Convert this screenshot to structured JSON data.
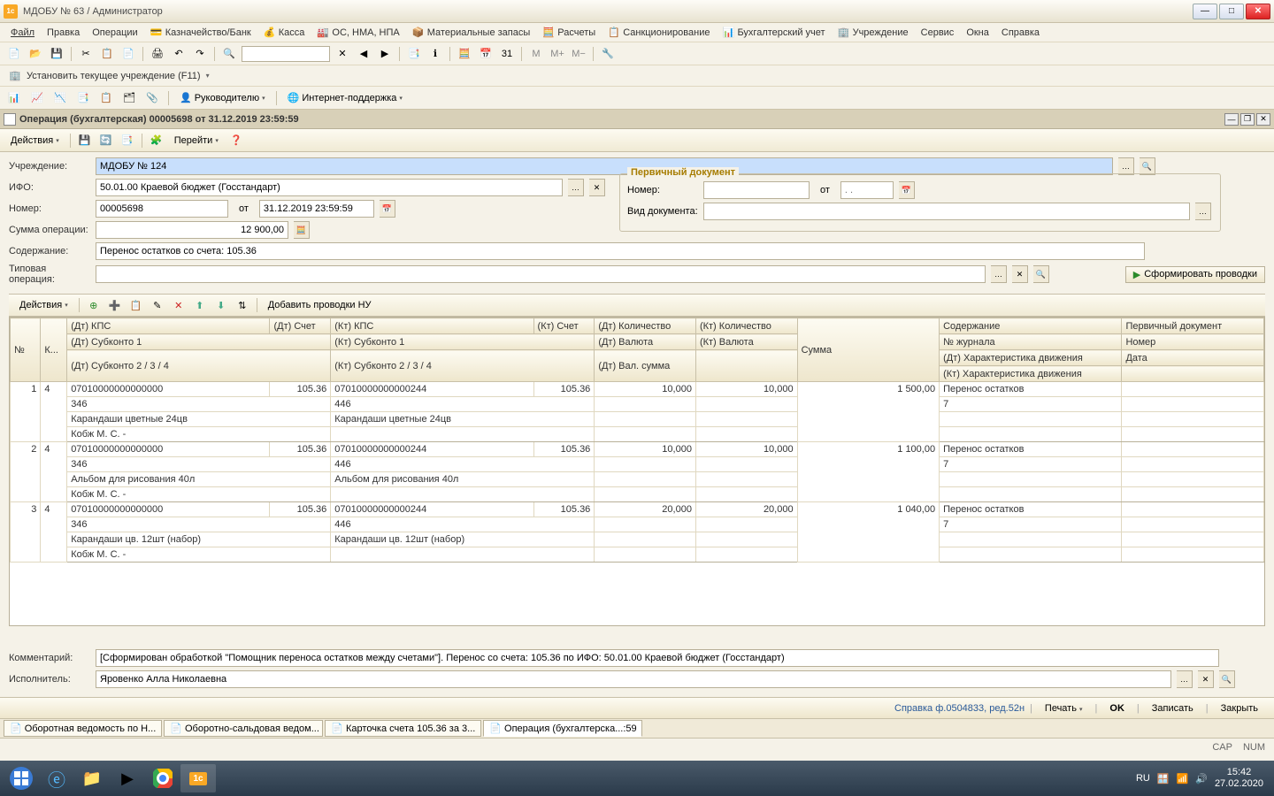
{
  "window": {
    "title": "МДОБУ № 63   / Администратор"
  },
  "menubar": [
    "Файл",
    "Правка",
    "Операции",
    "Казначейство/Банк",
    "Касса",
    "ОС, НМА, НПА",
    "Материальные запасы",
    "Расчеты",
    "Санкционирование",
    "Бухгалтерский учет",
    "Учреждение",
    "Сервис",
    "Окна",
    "Справка"
  ],
  "set_org": "Установить текущее учреждение (F11)",
  "toolbar2": {
    "manager": "Руководителю",
    "support": "Интернет-поддержка"
  },
  "doc_title": "Операция (бухгалтерская) 00005698 от 31.12.2019 23:59:59",
  "actions": {
    "label": "Действия",
    "go": "Перейти"
  },
  "form": {
    "org_label": "Учреждение:",
    "org_value": "МДОБУ № 124",
    "ifo_label": "ИФО:",
    "ifo_value": "50.01.00 Краевой бюджет (Госстандарт)",
    "num_label": "Номер:",
    "num_value": "00005698",
    "from": "от",
    "date_value": "31.12.2019 23:59:59",
    "sum_label": "Сумма операции:",
    "sum_value": "12 900,00",
    "content_label": "Содержание:",
    "content_value": "Перенос остатков со счета: 105.36",
    "typeop_label": "Типовая операция:"
  },
  "primary_doc": {
    "legend": "Первичный документ",
    "num_label": "Номер:",
    "from": "от",
    "date_placeholder": ". .",
    "kind_label": "Вид документа:"
  },
  "table_actions": {
    "actions": "Действия",
    "add_nu": "Добавить проводки НУ"
  },
  "gen_btn": "Сформировать проводки",
  "grid": {
    "headers": {
      "n": "№",
      "k": "К...",
      "dt_kps": "(Дт) КПС",
      "dt_acc": "(Дт) Счет",
      "kt_kps": "(Кт) КПС",
      "kt_acc": "(Кт) Счет",
      "dt_qty": "(Дт) Количество",
      "kt_qty": "(Кт) Количество",
      "sum": "Сумма",
      "content": "Содержание",
      "primdoc": "Первичный документ",
      "dt_sub1": "(Дт) Субконто 1",
      "kt_sub1": "(Кт) Субконто 1",
      "dt_cur": "(Дт) Валюта",
      "kt_cur": "(Кт) Валюта",
      "journal": "№ журнала",
      "pd_num": "Номер",
      "dt_sub234": "(Дт) Субконто 2 / 3 / 4",
      "kt_sub234": "(Кт) Субконто 2 / 3 / 4",
      "dt_valsum": "(Дт) Вал. сумма",
      "dt_char": "(Дт) Характеристика движения",
      "pd_date": "Дата",
      "kt_char": "(Кт) Характеристика движения"
    },
    "rows": [
      {
        "n": "1",
        "k": "4",
        "dt_kps": "07010000000000000",
        "dt_acc": "105.36",
        "kt_kps": "07010000000000244",
        "kt_acc": "105.36",
        "dt_qty": "10,000",
        "kt_qty": "10,000",
        "sum": "1 500,00",
        "content": "Перенос остатков",
        "dt_sub1": "346",
        "kt_sub1": "446",
        "journal": "7",
        "dt_sub2": "Карандаши цветные  24цв",
        "kt_sub2": "Карандаши цветные  24цв",
        "dt_sub3": "Кобж М. С. -"
      },
      {
        "n": "2",
        "k": "4",
        "dt_kps": "07010000000000000",
        "dt_acc": "105.36",
        "kt_kps": "07010000000000244",
        "kt_acc": "105.36",
        "dt_qty": "10,000",
        "kt_qty": "10,000",
        "sum": "1 100,00",
        "content": "Перенос остатков",
        "dt_sub1": "346",
        "kt_sub1": "446",
        "journal": "7",
        "dt_sub2": "Альбом для рисования 40л",
        "kt_sub2": "Альбом для рисования 40л",
        "dt_sub3": "Кобж М. С. -"
      },
      {
        "n": "3",
        "k": "4",
        "dt_kps": "07010000000000000",
        "dt_acc": "105.36",
        "kt_kps": "07010000000000244",
        "kt_acc": "105.36",
        "dt_qty": "20,000",
        "kt_qty": "20,000",
        "sum": "1 040,00",
        "content": "Перенос остатков",
        "dt_sub1": "346",
        "kt_sub1": "446",
        "journal": "7",
        "dt_sub2": "Карандаши цв. 12шт (набор)",
        "kt_sub2": "Карандаши цв. 12шт (набор)",
        "dt_sub3": "Кобж М. С. -"
      }
    ]
  },
  "bottom": {
    "comment_label": "Комментарий:",
    "comment_value": "[Сформирован обработкой \"Помощник переноса остатков между счетами\"]. Перенос со счета: 105.36 по ИФО: 50.01.00 Краевой бюджет (Госстандарт)",
    "exec_label": "Исполнитель:",
    "exec_value": "Яровенко Алла Николаевна"
  },
  "status": {
    "ref": "Справка ф.0504833, ред.52н",
    "print": "Печать",
    "ok": "OK",
    "save": "Записать",
    "close": "Закрыть"
  },
  "tabs_bottom": [
    "Оборотная ведомость по Н...",
    "Оборотно-сальдовая ведом...",
    "Карточка счета 105.36 за 3...",
    "Операция (бухгалтерска...:59"
  ],
  "indicators": {
    "cap": "CAP",
    "num": "NUM",
    "lang": "RU"
  },
  "tray": {
    "lang": "RU",
    "time": "15:42",
    "date": "27.02.2020"
  }
}
